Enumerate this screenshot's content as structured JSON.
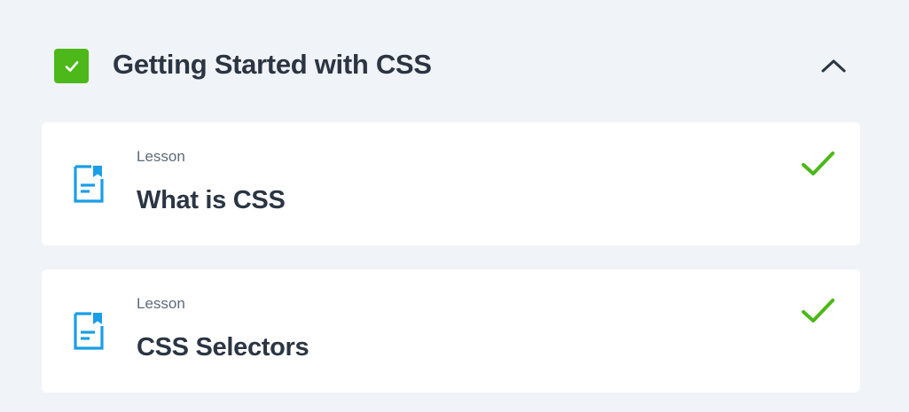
{
  "section": {
    "title": "Getting Started with CSS",
    "completed": true,
    "expanded": true,
    "check_icon": "checkbox-checked-icon",
    "toggle_icon": "chevron-up-icon"
  },
  "lessons": [
    {
      "type": "Lesson",
      "title": "What is CSS",
      "icon": "document-icon",
      "status_icon": "checkmark-icon",
      "completed": true
    },
    {
      "type": "Lesson",
      "title": "CSS Selectors",
      "icon": "document-icon",
      "status_icon": "checkmark-icon",
      "completed": true
    }
  ],
  "colors": {
    "background": "#f0f3f7",
    "card": "#ffffff",
    "success": "#4cb81a",
    "icon_blue": "#1a9ee8",
    "text_primary": "#2b3543",
    "text_secondary": "#5c6a7a"
  }
}
